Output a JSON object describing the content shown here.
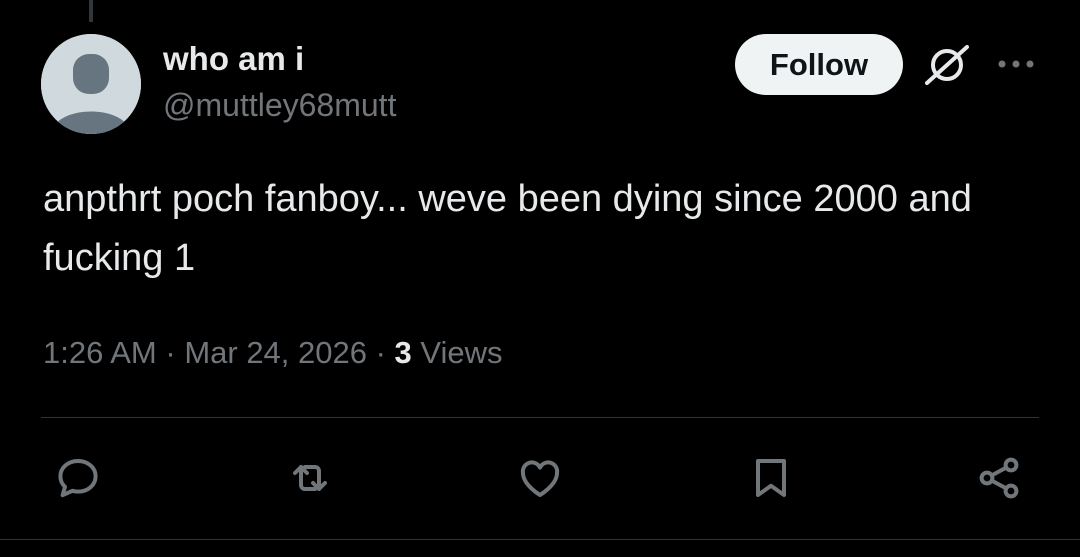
{
  "tweet": {
    "author": {
      "display_name": "who am i",
      "handle": "@muttley68mutt"
    },
    "follow_label": "Follow",
    "text": "anpthrt poch fanboy... weve been dying since 2000 and fucking 1",
    "time": "1:26 AM",
    "separator": " · ",
    "date": "Mar 24, 2026",
    "views_count": "3",
    "views_label": " Views"
  },
  "icons": {
    "grok": "grok-icon",
    "more": "more-icon",
    "reply": "reply-icon",
    "retweet": "retweet-icon",
    "like": "heart-icon",
    "bookmark": "bookmark-icon",
    "share": "share-icon"
  },
  "colors": {
    "background": "#000000",
    "primary_text": "#e7e9ea",
    "secondary_text": "#71767b",
    "follow_bg": "#eff3f4",
    "divider": "#2f3336"
  }
}
